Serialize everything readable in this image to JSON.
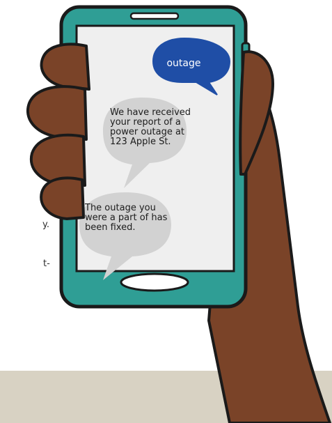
{
  "conversation": {
    "outgoing": {
      "text": "outage",
      "color": "#1f4ea6"
    },
    "incoming": [
      {
        "lines": [
          "We have received",
          "your report of a",
          "power outage at",
          "123 Apple St."
        ]
      },
      {
        "lines": [
          "The outage you",
          "were a part of has",
          "been fixed."
        ]
      }
    ]
  },
  "cropped_edge_text": [
    "y.",
    "t-"
  ],
  "colors": {
    "phone_body": "#2f9e95",
    "phone_outline": "#1a1a1a",
    "screen": "#efefef",
    "incoming_bubble": "#d2d2d2",
    "skin": "#7a4328",
    "background_band": "#d8d2c3"
  },
  "icons": {
    "earpiece": "speaker-slot-icon",
    "home_button": "home-button-icon"
  }
}
